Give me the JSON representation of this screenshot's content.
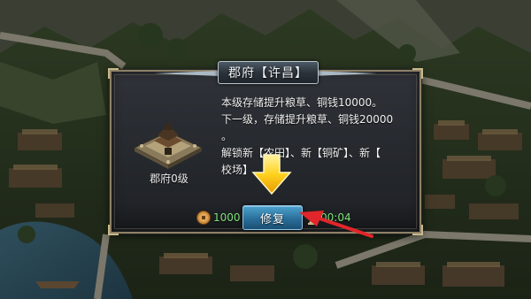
{
  "dialog": {
    "title": "郡府【许昌】",
    "building": {
      "icon": "walled-fortress-icon",
      "label": "郡府0级"
    },
    "description": [
      "本级存储提升粮草、铜钱10000。",
      "下一级，存储提升粮草、铜钱20000",
      "。",
      "解锁新【农田】、新【铜矿】、新【",
      "校场】"
    ],
    "cost": {
      "icon": "copper-coin-icon",
      "value": "1000"
    },
    "repair_button": {
      "label": "修复"
    },
    "timer": {
      "icon": "hourglass-icon",
      "value": "00:04"
    }
  },
  "tutorial": {
    "yellow_arrow_icon": "down-arrow-icon",
    "red_arrow_icon": "pointer-arrow-icon"
  },
  "colors": {
    "accent_green": "#7fe37a",
    "button_blue": "#2a6f9a",
    "frame_gold": "#8e8166",
    "arrow_yellow": "#ffd21f",
    "arrow_red": "#e0262a"
  }
}
